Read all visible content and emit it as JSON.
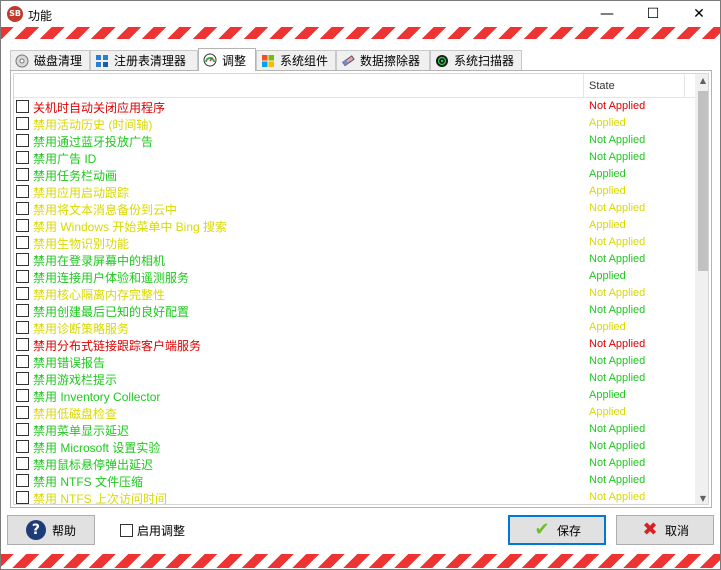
{
  "window": {
    "title": "功能",
    "app_icon_text": "SB",
    "minimize_glyph": "—",
    "maximize_glyph": "☐",
    "close_glyph": "✕"
  },
  "tabs": [
    {
      "label": "磁盘清理",
      "icon": "disk-icon",
      "active": false
    },
    {
      "label": "注册表清理器",
      "icon": "registry-icon",
      "active": false
    },
    {
      "label": "调整",
      "icon": "gauge-icon",
      "active": true
    },
    {
      "label": "系统组件",
      "icon": "windows-icon",
      "active": false
    },
    {
      "label": "数据擦除器",
      "icon": "eraser-icon",
      "active": false
    },
    {
      "label": "系统扫描器",
      "icon": "scanner-icon",
      "active": false
    }
  ],
  "list": {
    "state_header": "State",
    "rows": [
      {
        "label": "关机时自动关闭应用程序",
        "state": "Not Applied",
        "color": "#e00000"
      },
      {
        "label": "禁用活动历史 (时间轴)",
        "state": "Applied",
        "color": "#d9d900"
      },
      {
        "label": "禁用通过蓝牙投放广告",
        "state": "Not Applied",
        "color": "#1fc81f"
      },
      {
        "label": "禁用广告 ID",
        "state": "Not Applied",
        "color": "#1fc81f"
      },
      {
        "label": "禁用任务栏动画",
        "state": "Applied",
        "color": "#1fc81f"
      },
      {
        "label": "禁用应用启动跟踪",
        "state": "Applied",
        "color": "#d9d900"
      },
      {
        "label": "禁用将文本消息备份到云中",
        "state": "Not Applied",
        "color": "#d9d900"
      },
      {
        "label": "禁用 Windows 开始菜单中 Bing 搜索",
        "state": "Applied",
        "color": "#d9d900"
      },
      {
        "label": "禁用生物识别功能",
        "state": "Not Applied",
        "color": "#d9d900"
      },
      {
        "label": "禁用在登录屏幕中的相机",
        "state": "Not Applied",
        "color": "#1fc81f"
      },
      {
        "label": "禁用连接用户体验和遥测服务",
        "state": "Applied",
        "color": "#1fc81f"
      },
      {
        "label": "禁用核心隔离内存完整性",
        "state": "Not Applied",
        "color": "#d9d900"
      },
      {
        "label": "禁用创建最后已知的良好配置",
        "state": "Not Applied",
        "color": "#1fc81f"
      },
      {
        "label": "禁用诊断策略服务",
        "state": "Applied",
        "color": "#d9d900"
      },
      {
        "label": "禁用分布式链接跟踪客户端服务",
        "state": "Not Applied",
        "color": "#e00000"
      },
      {
        "label": "禁用错误报告",
        "state": "Not Applied",
        "color": "#1fc81f"
      },
      {
        "label": "禁用游戏栏提示",
        "state": "Not Applied",
        "color": "#1fc81f"
      },
      {
        "label": "禁用 Inventory Collector",
        "state": "Applied",
        "color": "#1fc81f"
      },
      {
        "label": "禁用低磁盘检查",
        "state": "Applied",
        "color": "#d9d900"
      },
      {
        "label": "禁用菜单显示延迟",
        "state": "Not Applied",
        "color": "#1fc81f"
      },
      {
        "label": "禁用 Microsoft 设置实验",
        "state": "Not Applied",
        "color": "#1fc81f"
      },
      {
        "label": "禁用鼠标悬停弹出延迟",
        "state": "Not Applied",
        "color": "#1fc81f"
      },
      {
        "label": "禁用 NTFS 文件压缩",
        "state": "Not Applied",
        "color": "#1fc81f"
      },
      {
        "label": "禁用 NTFS 上次访问时间",
        "state": "Not Applied",
        "color": "#d9d900"
      }
    ]
  },
  "footer": {
    "help_label": "帮助",
    "enable_tweaks_label": "启用调整",
    "save_label": "保存",
    "cancel_label": "取消"
  }
}
